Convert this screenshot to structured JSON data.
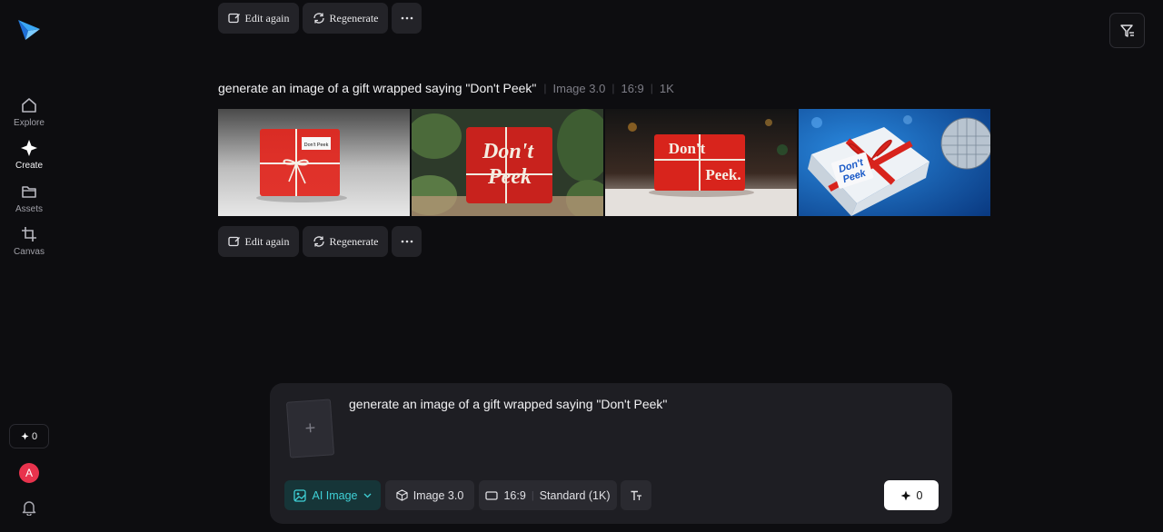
{
  "sidebar": {
    "items": [
      {
        "label": "Explore",
        "icon": "home-icon"
      },
      {
        "label": "Create",
        "icon": "sparkle-icon"
      },
      {
        "label": "Assets",
        "icon": "folder-icon"
      },
      {
        "label": "Canvas",
        "icon": "crop-icon"
      }
    ],
    "credits": "0",
    "avatar_initial": "A"
  },
  "top_actions": {
    "edit_again": "Edit again",
    "regenerate": "Regenerate",
    "more": "..."
  },
  "generation": {
    "prompt": "generate an image of a gift wrapped saying \"Don't Peek\"",
    "model": "Image 3.0",
    "ratio": "16:9",
    "resolution": "1K",
    "images": [
      {
        "caption": "Don't Peek",
        "style": "white-label"
      },
      {
        "caption_line1": "Don't",
        "caption_line2": "Peek",
        "style": "script"
      },
      {
        "caption_line1": "Don't",
        "caption_line2": "Peek.",
        "style": "bold"
      },
      {
        "caption_line1": "Don't",
        "caption_line2": "Peek",
        "style": "blue-card"
      }
    ],
    "actions": {
      "edit_again": "Edit again",
      "regenerate": "Regenerate",
      "more": "..."
    }
  },
  "composer": {
    "text": "generate an image of a gift wrapped saying \"Don't Peek\"",
    "upload_symbol": "+",
    "mode": "AI Image",
    "model": "Image 3.0",
    "ratio": "16:9",
    "quality": "Standard (1K)",
    "send_cost": "0"
  },
  "colors": {
    "accent": "#3fd0d6",
    "background": "#0d0d10",
    "avatar": "#e8334d"
  }
}
